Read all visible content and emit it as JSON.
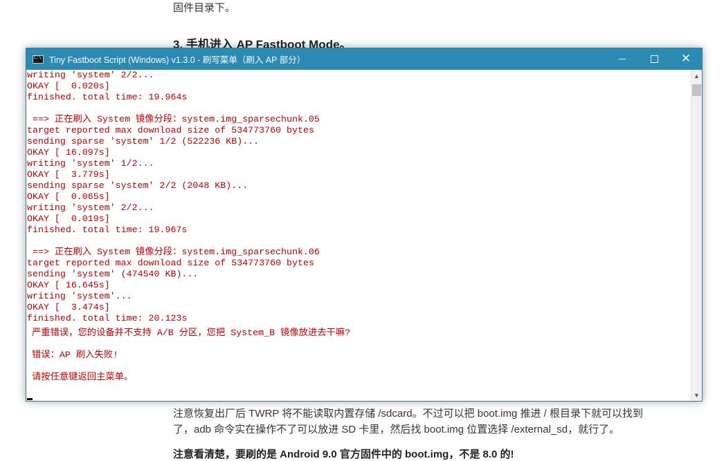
{
  "article": {
    "line1": "固件目录下。",
    "heading": "3. 手机进入 AP Fastboot Mode。",
    "para1_line1": "注意恢复出厂后 TWRP 将不能读取内置存储 /sdcard。不过可以把 boot.img 推进 / 根目录下就可以找到",
    "para1_line2": "了，adb 命令实在操作不了可以放进 SD 卡里，然后找 boot.img 位置选择 /external_sd，就行了。",
    "bold_line": "注意看清楚，要刷的是 Android 9.0 官方固件中的 boot.img，不是 8.0 的!"
  },
  "window": {
    "title": "Tiny Fastboot Script (Windows) v1.3.0 - 刷写菜单（刷入 AP 部分）",
    "icon": "cmd-icon",
    "minimize": "minimize-icon",
    "maximize": "maximize-icon",
    "close": "close-icon"
  },
  "console": {
    "lines": [
      "writing 'system' 2/2...",
      "OKAY [  0.020s]",
      "finished. total time: 19.964s",
      "",
      " ==> 正在刷入 System 镜像分段：system.img_sparsechunk.05",
      "target reported max download size of 534773760 bytes",
      "sending sparse 'system' 1/2 (522236 KB)...",
      "OKAY [ 16.097s]",
      "writing 'system' 1/2...",
      "OKAY [  3.779s]",
      "sending sparse 'system' 2/2 (2048 KB)...",
      "OKAY [  0.065s]",
      "writing 'system' 2/2...",
      "OKAY [  0.019s]",
      "finished. total time: 19.967s",
      "",
      " ==> 正在刷入 System 镜像分段：system.img_sparsechunk.06",
      "target reported max download size of 534773760 bytes",
      "sending 'system' (474540 KB)...",
      "OKAY [ 16.645s]",
      "writing 'system'...",
      "OKAY [  3.474s]",
      "finished. total time: 20.123s"
    ],
    "error1": "严重错误，您的设备并不支持 A/B 分区，您把 System_B 镜像放进去干嘛?",
    "error2": "错误：AP 刷入失败!",
    "prompt": "请按任意键返回主菜单。",
    "text_color": "#c00000"
  },
  "colors": {
    "titlebar": "#2a8ab4",
    "console_bg": "#ffffff"
  }
}
